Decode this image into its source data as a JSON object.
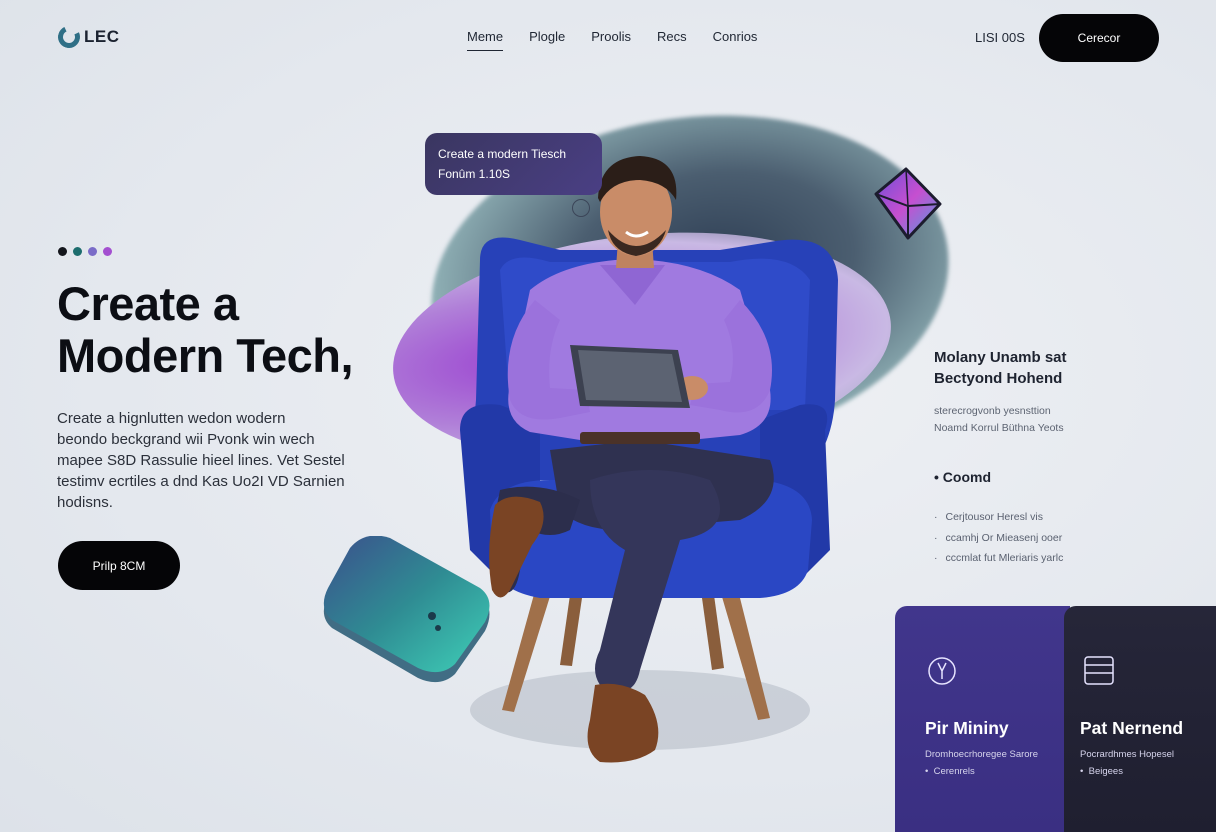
{
  "nav": {
    "logo_text": "LEC",
    "items": [
      {
        "label": "Meme",
        "active": true
      },
      {
        "label": "Plogle",
        "active": false
      },
      {
        "label": "Proolis",
        "active": false
      },
      {
        "label": "Recs",
        "active": false
      },
      {
        "label": "Conrios",
        "active": false
      }
    ],
    "signin_label": "LISI 00S",
    "cta_label": "Cerecor"
  },
  "hero": {
    "dot_colors": [
      "#14161c",
      "#1d6d6e",
      "#7a6cc8",
      "#a34fd0"
    ],
    "title_line1": "Create a",
    "title_line2": "Modern Tech,",
    "description_lines": [
      "Create a hignlutten wedon wodern",
      "beondo beckgrand wii Pvonk win wech",
      "mapee S8D Rassulie hieel lines. Vet Sestel",
      "testimv ecrtiles a dnd Kas Uo2I VD Sarnien",
      "hodisns."
    ],
    "button_label": "Prilp 8CM"
  },
  "bubble": {
    "line1": "Create a modern Tiesch",
    "line2": "Fonûm 1.10S"
  },
  "right_panel": {
    "title_line1": "Molany Unamb sat",
    "title_line2": "Bectyond Hohend",
    "sub_line1": "sterecrogvonb yesnsttion",
    "sub_line2": "Noamd Korrul Büthna Yeots",
    "bullet_label": "Coomd",
    "list": [
      "Cerjtousor Heresl vis",
      "ccamhj Or Mieasenj ooer",
      "cccmlat fut Mleriaris yarlc"
    ]
  },
  "cards": [
    {
      "title": "Pir Mininy",
      "desc1": "Dromhoecrhoregee Sarore",
      "desc2": "Cerenrels",
      "icon": "ring-tag-icon"
    },
    {
      "title": "Pat Nernend",
      "desc1": "Pocrardhmes Hopesel",
      "desc2": "Beigees",
      "icon": "browser-window-icon"
    }
  ],
  "colors": {
    "accent_purple": "#41368c",
    "dark_card": "#23233a",
    "button_black": "#050507"
  }
}
